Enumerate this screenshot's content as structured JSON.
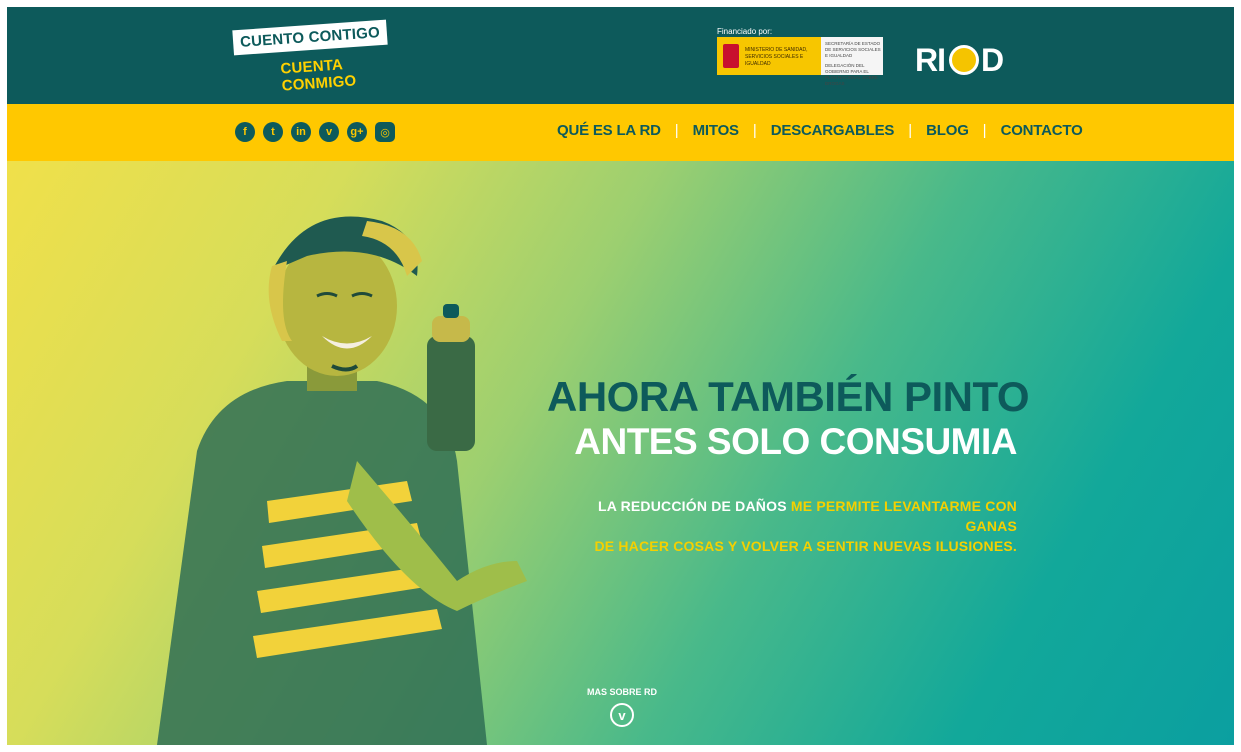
{
  "header": {
    "logo": {
      "line1": "CUENTO CONTIGO",
      "line2": "CUENTA CONMIGO"
    },
    "funding": {
      "caption": "Financiado por:",
      "ministry": "MINISTERIO DE SANIDAD, SERVICIOS SOCIALES E IGUALDAD",
      "secretaria": "SECRETARÍA DE ESTADO DE SERVICIOS SOCIALES E IGUALDAD",
      "delegacion": "DELEGACIÓN DEL GOBIERNO PARA EL PLAN NACIONAL SOBRE DROGAS"
    },
    "brand": {
      "left": "RI",
      "right": "D"
    }
  },
  "nav": {
    "social": [
      {
        "icon": "facebook-icon",
        "glyph": "f"
      },
      {
        "icon": "twitter-icon",
        "glyph": "t"
      },
      {
        "icon": "linkedin-icon",
        "glyph": "in"
      },
      {
        "icon": "vimeo-icon",
        "glyph": "v"
      },
      {
        "icon": "google-plus-icon",
        "glyph": "g+"
      },
      {
        "icon": "instagram-icon",
        "glyph": "◎"
      }
    ],
    "items": [
      "QUÉ ES LA RD",
      "MITOS",
      "DESCARGABLES",
      "BLOG",
      "CONTACTO"
    ],
    "separator": "|"
  },
  "hero": {
    "headline1": "AHORA TAMBIÉN PINTO",
    "headline2": "ANTES SOLO CONSUMIA",
    "body_lead": "LA REDUCCIÓN DE DAÑOS",
    "body_rest_line1": " ME PERMITE LEVANTARME CON GANAS",
    "body_rest_line2": "DE HACER COSAS Y VOLVER A SENTIR NUEVAS ILUSIONES.",
    "more_label": "MAS SOBRE RD",
    "more_icon_glyph": "v"
  },
  "colors": {
    "teal": "#0d5a5b",
    "yellow": "#ffc800",
    "accent_yellow": "#f5d000",
    "white": "#ffffff"
  }
}
